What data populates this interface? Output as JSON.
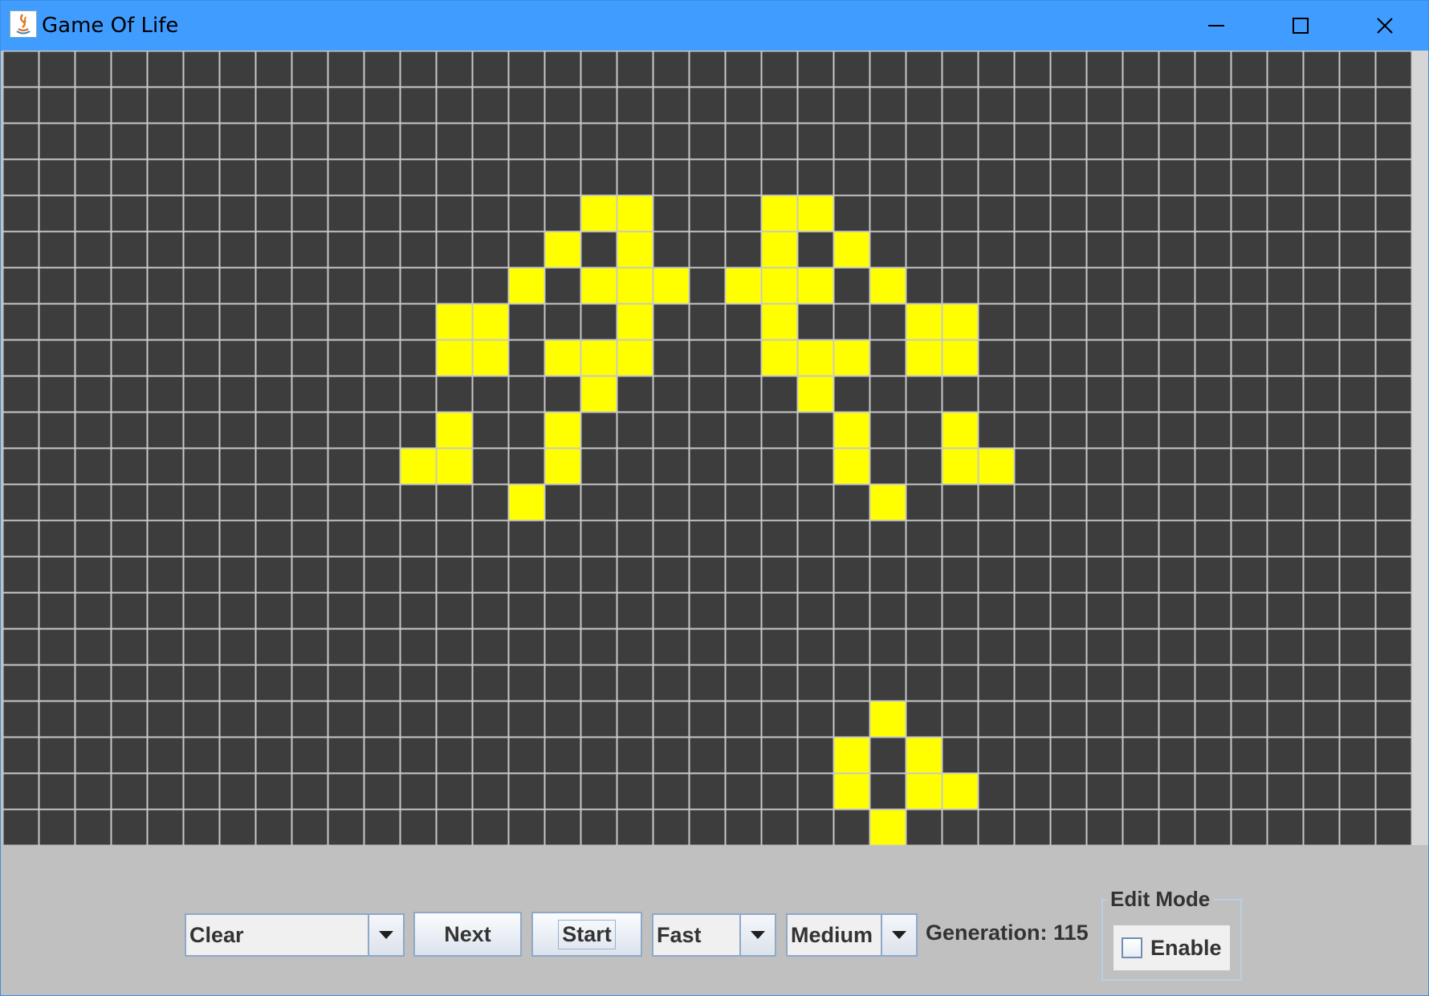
{
  "window": {
    "title": "Game Of Life",
    "icon": "java-icon"
  },
  "title_buttons": [
    "minimize-icon",
    "maximize-icon",
    "close-icon"
  ],
  "grid": {
    "cols": 39,
    "rows": 22,
    "background": "#3d3d3d",
    "line_color": "#c8c8c8",
    "live_color": "#ffff00",
    "live_cells": [
      [
        16,
        4
      ],
      [
        17,
        4
      ],
      [
        21,
        4
      ],
      [
        22,
        4
      ],
      [
        15,
        5
      ],
      [
        17,
        5
      ],
      [
        21,
        5
      ],
      [
        23,
        5
      ],
      [
        14,
        6
      ],
      [
        16,
        6
      ],
      [
        17,
        6
      ],
      [
        18,
        6
      ],
      [
        20,
        6
      ],
      [
        21,
        6
      ],
      [
        22,
        6
      ],
      [
        24,
        6
      ],
      [
        12,
        7
      ],
      [
        13,
        7
      ],
      [
        17,
        7
      ],
      [
        21,
        7
      ],
      [
        25,
        7
      ],
      [
        26,
        7
      ],
      [
        12,
        8
      ],
      [
        13,
        8
      ],
      [
        15,
        8
      ],
      [
        16,
        8
      ],
      [
        17,
        8
      ],
      [
        21,
        8
      ],
      [
        22,
        8
      ],
      [
        23,
        8
      ],
      [
        25,
        8
      ],
      [
        26,
        8
      ],
      [
        16,
        9
      ],
      [
        22,
        9
      ],
      [
        12,
        10
      ],
      [
        15,
        10
      ],
      [
        23,
        10
      ],
      [
        26,
        10
      ],
      [
        11,
        11
      ],
      [
        12,
        11
      ],
      [
        15,
        11
      ],
      [
        23,
        11
      ],
      [
        26,
        11
      ],
      [
        27,
        11
      ],
      [
        14,
        12
      ],
      [
        24,
        12
      ],
      [
        24,
        18
      ],
      [
        23,
        19
      ],
      [
        25,
        19
      ],
      [
        23,
        20
      ],
      [
        25,
        20
      ],
      [
        26,
        20
      ],
      [
        24,
        21
      ]
    ]
  },
  "controls": {
    "pattern_select": {
      "value": "Clear"
    },
    "next_button": "Next",
    "start_button": "Start",
    "speed_select": {
      "value": "Fast"
    },
    "size_select": {
      "value": "Medium"
    },
    "generation_label": "Generation: 115",
    "edit_mode": {
      "legend": "Edit Mode",
      "checkbox_label": "Enable",
      "checked": false
    }
  }
}
